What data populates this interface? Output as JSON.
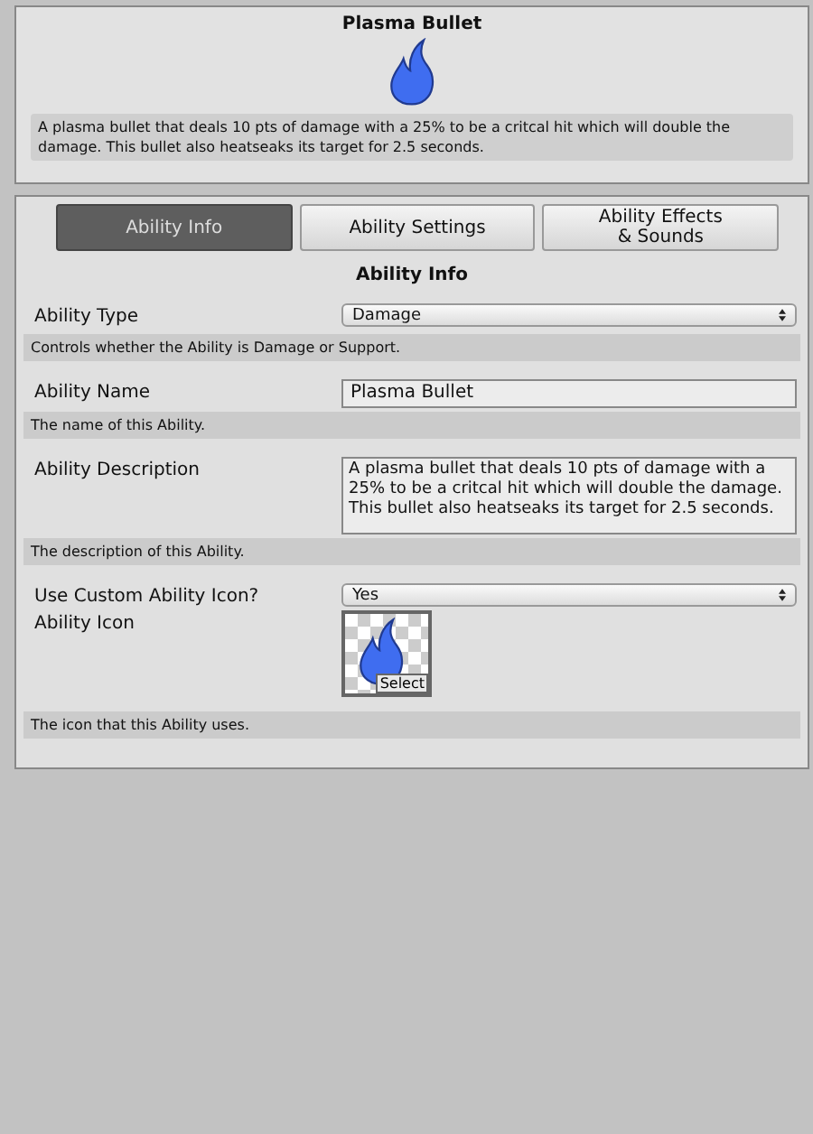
{
  "preview": {
    "title": "Plasma Bullet",
    "description": "A plasma bullet that deals 10 pts of damage with a 25% to be a critcal hit which will double the damage. This bullet also heatseaks its target for 2.5 seconds."
  },
  "tabs": [
    {
      "label": "Ability Info",
      "selected": true
    },
    {
      "label": "Ability Settings",
      "selected": false
    },
    {
      "label": "Ability Effects\n& Sounds",
      "selected": false
    }
  ],
  "section_title": "Ability Info",
  "fields": [
    {
      "kind": "dropdown",
      "label": "Ability Type",
      "value": "Damage",
      "help": "Controls whether the Ability is Damage or Support."
    },
    {
      "kind": "text",
      "label": "Ability Name",
      "value": "Plasma Bullet",
      "help": "The name of this Ability."
    },
    {
      "kind": "textarea",
      "label": "Ability Description",
      "value": "A plasma bullet that deals 10 pts of damage with a 25% to be a critcal hit which will double the damage. This bullet also heatseaks its target for 2.5 seconds.",
      "help": "The description of this Ability."
    },
    {
      "kind": "dropdown",
      "label": "Use Custom Ability Icon?",
      "value": "Yes"
    },
    {
      "kind": "icon",
      "label": "Ability Icon",
      "button": "Select",
      "help": "The icon that this Ability uses."
    }
  ]
}
